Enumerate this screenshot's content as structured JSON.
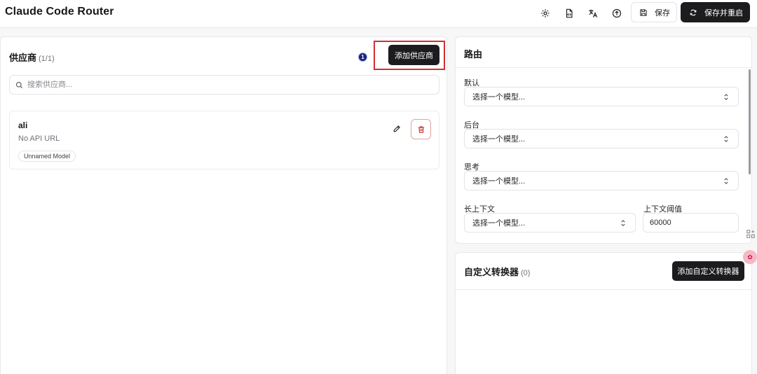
{
  "app": {
    "title": "Claude Code Router"
  },
  "toolbar": {
    "icons": [
      "gear-icon",
      "file-code-icon",
      "translate-icon",
      "upload-circle-icon"
    ],
    "save_label": "保存",
    "save_restart_label": "保存并重启"
  },
  "providers": {
    "title": "供应商",
    "count": "(1/1)",
    "step_badge": "1",
    "add_button": "添加供应商",
    "search_placeholder": "搜索供应商...",
    "items": [
      {
        "name": "ali",
        "api_url": "No API URL",
        "models": [
          "Unnamed Model"
        ]
      }
    ]
  },
  "routing": {
    "title": "路由",
    "fields": [
      {
        "label": "默认",
        "placeholder": "选择一个模型..."
      },
      {
        "label": "后台",
        "placeholder": "选择一个模型..."
      },
      {
        "label": "思考",
        "placeholder": "选择一个模型..."
      },
      {
        "label": "长上下文",
        "placeholder": "选择一个模型..."
      }
    ],
    "threshold": {
      "label": "上下文阈值",
      "value": "60000"
    }
  },
  "transformers": {
    "title": "自定义转换器",
    "count": "(0)",
    "add_button": "添加自定义转换器"
  },
  "colors": {
    "primary_dark": "#1c1c1e",
    "highlight": "#d32f2f",
    "badge": "#1a237e",
    "delete": "#d32f2f"
  }
}
